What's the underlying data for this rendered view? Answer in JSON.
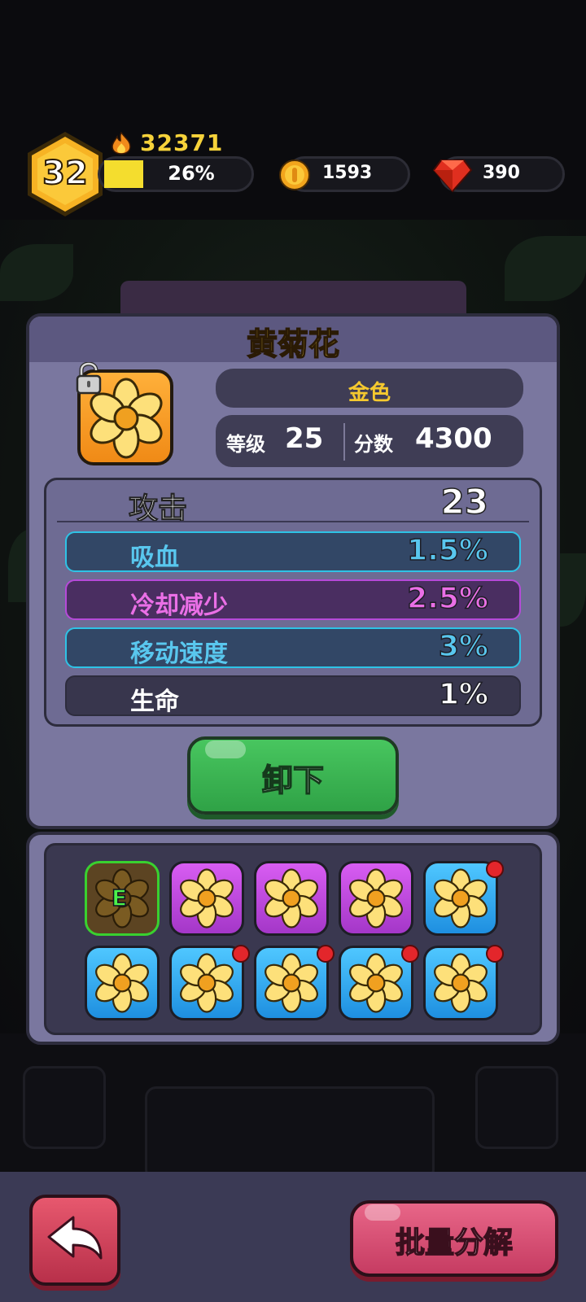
{
  "player": {
    "level": "32",
    "power": "32371",
    "xp_percent_label": "26%",
    "xp_progress": 0.26
  },
  "resources": {
    "coins": "1593",
    "gems": "390"
  },
  "item": {
    "name": "黄菊花",
    "quality": "金色",
    "level_label": "等级",
    "level_value": "25",
    "score_label": "分数",
    "score_value": "4300",
    "locked": true
  },
  "stats": {
    "attack_label": "攻击",
    "attack_value": "23",
    "rows": [
      {
        "label": "吸血",
        "value": "1.5%",
        "color": "#59c7ee"
      },
      {
        "label": "冷却减少",
        "value": "2.5%",
        "color": "#ea6fe6"
      },
      {
        "label": "移动速度",
        "value": "3%",
        "color": "#59c7ee"
      },
      {
        "label": "生命",
        "value": "1%",
        "color": "#ffffff"
      }
    ]
  },
  "actions": {
    "unequip": "卸下",
    "batch_decompose": "批量分解"
  },
  "inventory": {
    "equipped_mark": "E",
    "slots": [
      {
        "rarity": "gold",
        "equipped": true,
        "new": false
      },
      {
        "rarity": "purple",
        "equipped": false,
        "new": false
      },
      {
        "rarity": "purple",
        "equipped": false,
        "new": false
      },
      {
        "rarity": "purple",
        "equipped": false,
        "new": false
      },
      {
        "rarity": "blue",
        "equipped": false,
        "new": true
      },
      {
        "rarity": "blue",
        "equipped": false,
        "new": false
      },
      {
        "rarity": "blue",
        "equipped": false,
        "new": true
      },
      {
        "rarity": "blue",
        "equipped": false,
        "new": true
      },
      {
        "rarity": "blue",
        "equipped": false,
        "new": true
      },
      {
        "rarity": "blue",
        "equipped": false,
        "new": true
      }
    ]
  },
  "icons": {
    "level_badge": "hexagon-level-icon",
    "power": "flame-icon",
    "coin": "coin-icon",
    "gem": "ruby-gem-icon",
    "lock": "padlock-open-icon",
    "item": "daisy-flower-icon",
    "back": "return-arrow-icon"
  },
  "colors": {
    "gold": "#f5c92f",
    "unequip_button": "#3fb655",
    "batch_button": "#d84e74",
    "panel": "#7a779f"
  }
}
